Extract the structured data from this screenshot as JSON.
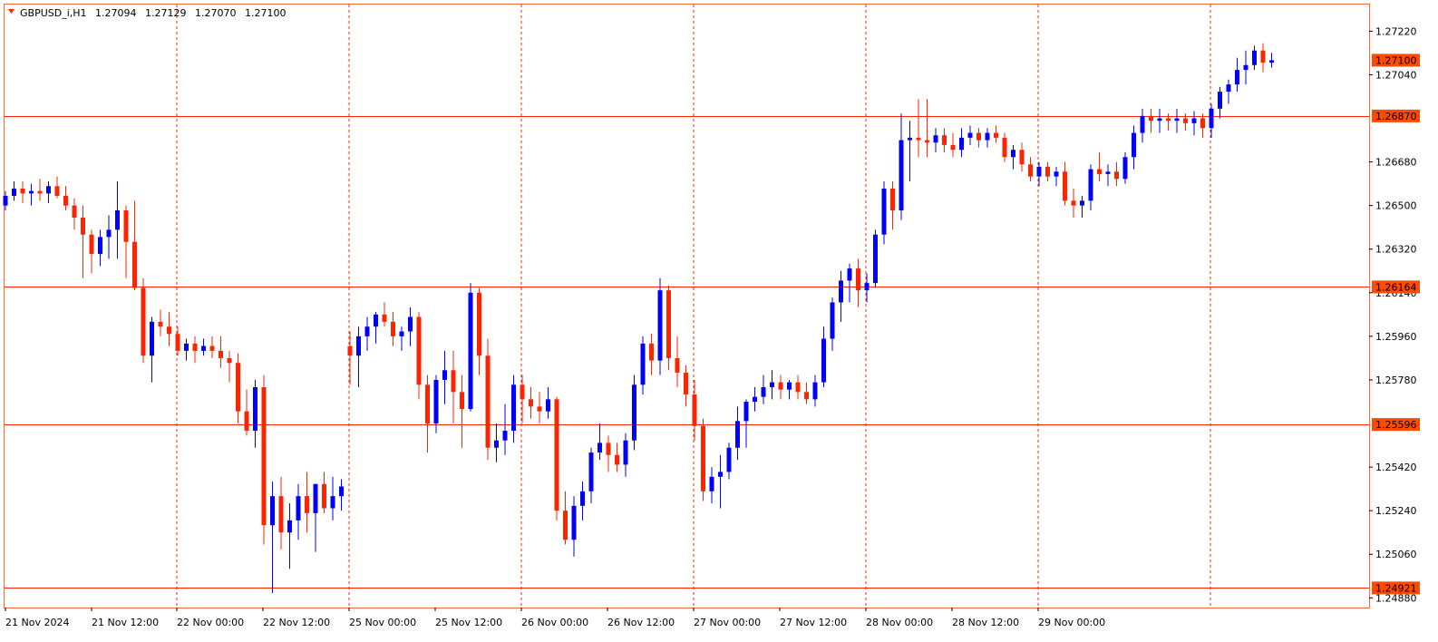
{
  "symbol_header": {
    "symbol": "GBPUSD_i,H1",
    "open": "1.27094",
    "high": "1.27129",
    "low": "1.27070",
    "close": "1.27100",
    "menu_icon": "triangle-down-icon"
  },
  "colors": {
    "background": "#ffffff",
    "frame": "#f26b3a",
    "bull": "#0000ff",
    "bear": "#ff2400",
    "level_line": "#ff2400",
    "vgrid": "#ff2400",
    "badge_fill": "#ff4a00",
    "price_badge_fill": "#ff4a00",
    "axis_text": "#000000"
  },
  "chart_data": {
    "type": "candlestick",
    "timeframe": "H1",
    "y_ticks": [
      "1.27220",
      "1.27040",
      "1.26680",
      "1.26500",
      "1.26320",
      "1.26140",
      "1.25960",
      "1.25780",
      "1.25420",
      "1.25240",
      "1.25060",
      "1.24880"
    ],
    "ylim": [
      1.2484,
      1.2733
    ],
    "x_labels": [
      "21 Nov 2024",
      "21 Nov 12:00",
      "22 Nov 00:00",
      "22 Nov 12:00",
      "25 Nov 00:00",
      "25 Nov 12:00",
      "26 Nov 00:00",
      "26 Nov 12:00",
      "27 Nov 00:00",
      "27 Nov 12:00",
      "28 Nov 00:00",
      "28 Nov 12:00",
      "29 Nov 00:00"
    ],
    "levels": [
      "1.26870",
      "1.26164",
      "1.25596",
      "1.24921"
    ],
    "current_price": "1.27100",
    "grid": "vertical dashed at day boundaries",
    "ohlc": [
      [
        1.265,
        1.2656,
        1.2648,
        1.2654
      ],
      [
        1.2654,
        1.266,
        1.2652,
        1.2657
      ],
      [
        1.2657,
        1.266,
        1.2651,
        1.2655
      ],
      [
        1.2655,
        1.2659,
        1.265,
        1.2656
      ],
      [
        1.2656,
        1.2661,
        1.2652,
        1.2655
      ],
      [
        1.2655,
        1.266,
        1.2651,
        1.2658
      ],
      [
        1.2658,
        1.2662,
        1.2653,
        1.2654
      ],
      [
        1.2654,
        1.2658,
        1.2648,
        1.265
      ],
      [
        1.265,
        1.2653,
        1.264,
        1.2645
      ],
      [
        1.2645,
        1.265,
        1.262,
        1.2638
      ],
      [
        1.2638,
        1.264,
        1.2622,
        1.263
      ],
      [
        1.263,
        1.264,
        1.2625,
        1.2637
      ],
      [
        1.2637,
        1.2646,
        1.2628,
        1.264
      ],
      [
        1.264,
        1.266,
        1.2628,
        1.2648
      ],
      [
        1.2648,
        1.265,
        1.262,
        1.2635
      ],
      [
        1.2635,
        1.2652,
        1.2615,
        1.2616
      ],
      [
        1.2616,
        1.262,
        1.2585,
        1.2588
      ],
      [
        1.2588,
        1.2604,
        1.2577,
        1.2602
      ],
      [
        1.2602,
        1.2607,
        1.2596,
        1.26
      ],
      [
        1.26,
        1.2606,
        1.2592,
        1.2597
      ],
      [
        1.2597,
        1.26,
        1.2588,
        1.259
      ],
      [
        1.259,
        1.2595,
        1.2586,
        1.2593
      ],
      [
        1.2593,
        1.2596,
        1.2585,
        1.259
      ],
      [
        1.259,
        1.2595,
        1.2588,
        1.2592
      ],
      [
        1.2592,
        1.2596,
        1.2587,
        1.259
      ],
      [
        1.259,
        1.2596,
        1.2583,
        1.2587
      ],
      [
        1.2587,
        1.259,
        1.2577,
        1.2585
      ],
      [
        1.2585,
        1.2589,
        1.256,
        1.2565
      ],
      [
        1.2565,
        1.2574,
        1.2555,
        1.2557
      ],
      [
        1.2557,
        1.2578,
        1.255,
        1.2575
      ],
      [
        1.2575,
        1.258,
        1.251,
        1.2518
      ],
      [
        1.2518,
        1.2536,
        1.249,
        1.253
      ],
      [
        1.253,
        1.2538,
        1.2508,
        1.2515
      ],
      [
        1.2515,
        1.2527,
        1.25,
        1.252
      ],
      [
        1.252,
        1.2535,
        1.2512,
        1.253
      ],
      [
        1.253,
        1.254,
        1.2515,
        1.2523
      ],
      [
        1.2523,
        1.2535,
        1.2507,
        1.2535
      ],
      [
        1.2535,
        1.254,
        1.2523,
        1.2525
      ],
      [
        1.2525,
        1.2538,
        1.252,
        1.253
      ],
      [
        1.253,
        1.2537,
        1.2524,
        1.2534
      ],
      [
        1.2592,
        1.2598,
        1.2576,
        1.2588
      ],
      [
        1.2588,
        1.26,
        1.2575,
        1.2596
      ],
      [
        1.2596,
        1.2604,
        1.259,
        1.26
      ],
      [
        1.26,
        1.2606,
        1.2593,
        1.2605
      ],
      [
        1.2605,
        1.261,
        1.26,
        1.2602
      ],
      [
        1.2602,
        1.2606,
        1.2592,
        1.2596
      ],
      [
        1.2596,
        1.26,
        1.259,
        1.2598
      ],
      [
        1.2598,
        1.2608,
        1.2592,
        1.2604
      ],
      [
        1.2604,
        1.2606,
        1.257,
        1.2576
      ],
      [
        1.2576,
        1.258,
        1.2548,
        1.256
      ],
      [
        1.256,
        1.258,
        1.2556,
        1.2578
      ],
      [
        1.2578,
        1.259,
        1.2568,
        1.2582
      ],
      [
        1.2582,
        1.259,
        1.256,
        1.2573
      ],
      [
        1.2573,
        1.258,
        1.255,
        1.2566
      ],
      [
        1.2566,
        1.2618,
        1.2565,
        1.2614
      ],
      [
        1.2614,
        1.2616,
        1.258,
        1.2588
      ],
      [
        1.2588,
        1.2595,
        1.2545,
        1.255
      ],
      [
        1.255,
        1.256,
        1.2544,
        1.2553
      ],
      [
        1.2553,
        1.2568,
        1.2547,
        1.2557
      ],
      [
        1.2557,
        1.258,
        1.2552,
        1.2576
      ],
      [
        1.2576,
        1.258,
        1.256,
        1.257
      ],
      [
        1.257,
        1.2575,
        1.2562,
        1.2567
      ],
      [
        1.2567,
        1.2573,
        1.256,
        1.2565
      ],
      [
        1.2565,
        1.2575,
        1.2562,
        1.257
      ],
      [
        1.257,
        1.2571,
        1.252,
        1.2524
      ],
      [
        1.2524,
        1.2532,
        1.251,
        1.2512
      ],
      [
        1.2512,
        1.253,
        1.2505,
        1.2526
      ],
      [
        1.2526,
        1.2536,
        1.252,
        1.2532
      ],
      [
        1.2532,
        1.255,
        1.2527,
        1.2548
      ],
      [
        1.2548,
        1.256,
        1.2545,
        1.2552
      ],
      [
        1.2552,
        1.2555,
        1.254,
        1.2547
      ],
      [
        1.2547,
        1.2552,
        1.254,
        1.2543
      ],
      [
        1.2543,
        1.2556,
        1.2538,
        1.2553
      ],
      [
        1.2553,
        1.258,
        1.2549,
        1.2576
      ],
      [
        1.2576,
        1.2596,
        1.2572,
        1.2593
      ],
      [
        1.2593,
        1.2597,
        1.258,
        1.2586
      ],
      [
        1.2586,
        1.262,
        1.258,
        1.2615
      ],
      [
        1.2615,
        1.2617,
        1.2582,
        1.2587
      ],
      [
        1.2587,
        1.2596,
        1.2575,
        1.2581
      ],
      [
        1.2581,
        1.2584,
        1.2567,
        1.2572
      ],
      [
        1.2572,
        1.2578,
        1.2553,
        1.2559
      ],
      [
        1.2559,
        1.2562,
        1.2528,
        1.2532
      ],
      [
        1.2532,
        1.2542,
        1.2527,
        1.2538
      ],
      [
        1.2538,
        1.2547,
        1.2525,
        1.254
      ],
      [
        1.254,
        1.2552,
        1.2537,
        1.255
      ],
      [
        1.255,
        1.2567,
        1.2545,
        1.2561
      ],
      [
        1.2561,
        1.257,
        1.255,
        1.2569
      ],
      [
        1.2569,
        1.2575,
        1.2565,
        1.2571
      ],
      [
        1.2571,
        1.258,
        1.2568,
        1.2575
      ],
      [
        1.2575,
        1.2582,
        1.257,
        1.2577
      ],
      [
        1.2577,
        1.258,
        1.257,
        1.2574
      ],
      [
        1.2574,
        1.2578,
        1.257,
        1.2577
      ],
      [
        1.2577,
        1.258,
        1.257,
        1.2573
      ],
      [
        1.2573,
        1.2577,
        1.2568,
        1.257
      ],
      [
        1.257,
        1.258,
        1.2567,
        1.2577
      ],
      [
        1.2577,
        1.26,
        1.2575,
        1.2595
      ],
      [
        1.2595,
        1.2612,
        1.259,
        1.261
      ],
      [
        1.261,
        1.2623,
        1.2602,
        1.2619
      ],
      [
        1.2619,
        1.2626,
        1.261,
        1.2624
      ],
      [
        1.2624,
        1.2628,
        1.2608,
        1.2615
      ],
      [
        1.2615,
        1.2622,
        1.261,
        1.2618
      ],
      [
        1.2618,
        1.264,
        1.2616,
        1.2638
      ],
      [
        1.2638,
        1.266,
        1.2634,
        1.2657
      ],
      [
        1.2657,
        1.266,
        1.264,
        1.2648
      ],
      [
        1.2648,
        1.2688,
        1.2644,
        1.2677
      ],
      [
        1.2677,
        1.2685,
        1.266,
        1.2678
      ],
      [
        1.2678,
        1.2694,
        1.267,
        1.2677
      ],
      [
        1.2677,
        1.2694,
        1.267,
        1.2676
      ],
      [
        1.2676,
        1.2682,
        1.2672,
        1.2679
      ],
      [
        1.2679,
        1.2682,
        1.2672,
        1.2675
      ],
      [
        1.2675,
        1.268,
        1.267,
        1.2673
      ],
      [
        1.2673,
        1.2682,
        1.267,
        1.2678
      ],
      [
        1.2678,
        1.2683,
        1.2675,
        1.268
      ],
      [
        1.268,
        1.2682,
        1.2674,
        1.2677
      ],
      [
        1.2677,
        1.2682,
        1.2674,
        1.268
      ],
      [
        1.268,
        1.2683,
        1.2676,
        1.2678
      ],
      [
        1.2678,
        1.268,
        1.2668,
        1.267
      ],
      [
        1.267,
        1.2675,
        1.2665,
        1.2673
      ],
      [
        1.2673,
        1.2676,
        1.2664,
        1.2667
      ],
      [
        1.2667,
        1.267,
        1.266,
        1.2662
      ],
      [
        1.2662,
        1.2668,
        1.2658,
        1.2666
      ],
      [
        1.2666,
        1.2668,
        1.266,
        1.2662
      ],
      [
        1.2662,
        1.2666,
        1.2658,
        1.2664
      ],
      [
        1.2664,
        1.2668,
        1.265,
        1.2652
      ],
      [
        1.2652,
        1.2657,
        1.2645,
        1.265
      ],
      [
        1.265,
        1.2654,
        1.2645,
        1.2652
      ],
      [
        1.2652,
        1.2667,
        1.2648,
        1.2665
      ],
      [
        1.2665,
        1.2672,
        1.266,
        1.2663
      ],
      [
        1.2663,
        1.2667,
        1.2658,
        1.2664
      ],
      [
        1.2664,
        1.2668,
        1.2658,
        1.2661
      ],
      [
        1.2661,
        1.2672,
        1.2659,
        1.267
      ],
      [
        1.267,
        1.2683,
        1.2665,
        1.268
      ],
      [
        1.268,
        1.269,
        1.2676,
        1.2687
      ],
      [
        1.2687,
        1.269,
        1.268,
        1.2685
      ],
      [
        1.2685,
        1.269,
        1.268,
        1.2686
      ],
      [
        1.2686,
        1.2688,
        1.2681,
        1.2685
      ],
      [
        1.2685,
        1.269,
        1.268,
        1.2686
      ],
      [
        1.2686,
        1.2688,
        1.2681,
        1.2684
      ],
      [
        1.2684,
        1.2689,
        1.2679,
        1.2686
      ],
      [
        1.2686,
        1.2688,
        1.2678,
        1.2682
      ],
      [
        1.2682,
        1.2692,
        1.2678,
        1.269
      ],
      [
        1.269,
        1.2699,
        1.2686,
        1.2697
      ],
      [
        1.2697,
        1.2702,
        1.2692,
        1.27
      ],
      [
        1.27,
        1.2711,
        1.2697,
        1.2706
      ],
      [
        1.2706,
        1.2714,
        1.27,
        1.2708
      ],
      [
        1.2708,
        1.2716,
        1.2706,
        1.2714
      ],
      [
        1.2714,
        1.2717,
        1.2705,
        1.2709
      ],
      [
        1.2709,
        1.2713,
        1.2707,
        1.271
      ]
    ]
  }
}
